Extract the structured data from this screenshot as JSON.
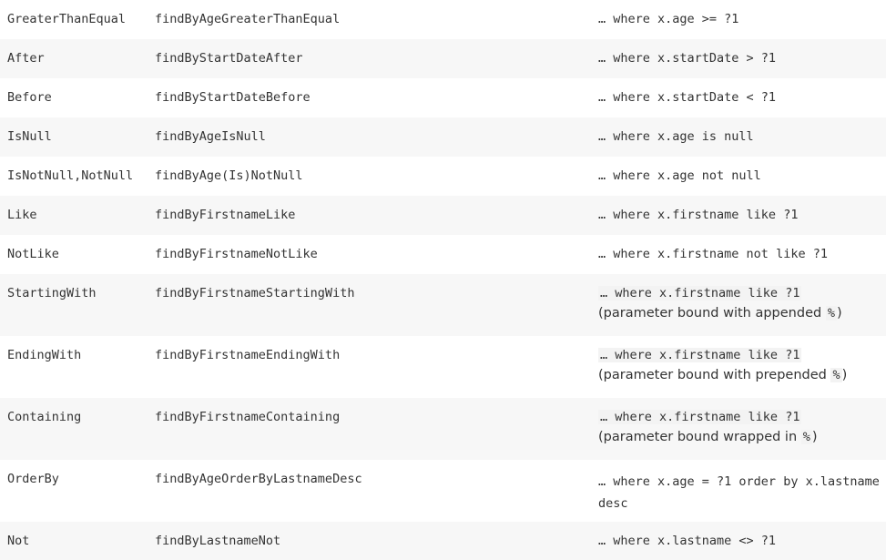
{
  "rows": [
    {
      "keyword": "GreaterThanEqual",
      "sample": "findByAgeGreaterThanEqual",
      "jpql": "… where x.age >= ?1"
    },
    {
      "keyword": "After",
      "sample": "findByStartDateAfter",
      "jpql": "… where x.startDate > ?1"
    },
    {
      "keyword": "Before",
      "sample": "findByStartDateBefore",
      "jpql": "… where x.startDate < ?1"
    },
    {
      "keyword": "IsNull",
      "sample": "findByAgeIsNull",
      "jpql": "… where x.age is null"
    },
    {
      "keyword": "IsNotNull,NotNull",
      "sample": "findByAge(Is)NotNull",
      "jpql": "… where x.age not null"
    },
    {
      "keyword": "Like",
      "sample": "findByFirstnameLike",
      "jpql": "… where x.firstname like ?1"
    },
    {
      "keyword": "NotLike",
      "sample": "findByFirstnameNotLike",
      "jpql": "… where x.firstname not like ?1"
    },
    {
      "keyword": "StartingWith",
      "sample": "findByFirstnameStartingWith",
      "jpql": "… where x.firstname like ?1",
      "note_prefix": "(parameter bound with appended ",
      "note_code": "%",
      "note_suffix": ")"
    },
    {
      "keyword": "EndingWith",
      "sample": "findByFirstnameEndingWith",
      "jpql": "… where x.firstname like ?1",
      "note_prefix": "(parameter bound with prepended ",
      "note_code": "%",
      "note_suffix": ")"
    },
    {
      "keyword": "Containing",
      "sample": "findByFirstnameContaining",
      "jpql": "… where x.firstname like ?1",
      "note_prefix": "(parameter bound wrapped in ",
      "note_code": "%",
      "note_suffix": ")"
    },
    {
      "keyword": "OrderBy",
      "sample": "findByAgeOrderByLastnameDesc",
      "jpql": "… where x.age = ?1 order by x.lastname desc"
    },
    {
      "keyword": "Not",
      "sample": "findByLastnameNot",
      "jpql": "… where x.lastname <> ?1"
    }
  ]
}
